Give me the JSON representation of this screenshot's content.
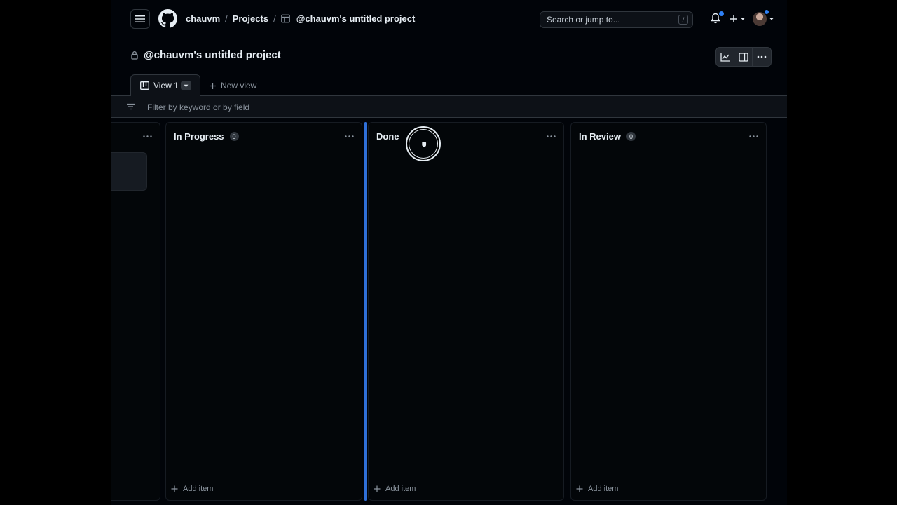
{
  "header": {
    "breadcrumb_user": "chauvm",
    "breadcrumb_separator": "/",
    "breadcrumb_projects": "Projects",
    "breadcrumb_project": "@chauvm's untitled project",
    "search_placeholder": "Search or jump to...",
    "search_shortcut": "/"
  },
  "project": {
    "title": "@chauvm's untitled project"
  },
  "views": {
    "active_tab": "View 1",
    "new_view": "New view"
  },
  "filter": {
    "placeholder": "Filter by keyword or by field"
  },
  "columns": [
    {
      "title": "",
      "count": "",
      "add_label": ""
    },
    {
      "title": "In Progress",
      "count": "0",
      "add_label": "Add item"
    },
    {
      "title": "Done",
      "count": "",
      "add_label": "Add item"
    },
    {
      "title": "In Review",
      "count": "0",
      "add_label": "Add item"
    }
  ],
  "colors": {
    "accent": "#2f81f7",
    "background": "#010409",
    "border": "#30363d"
  }
}
